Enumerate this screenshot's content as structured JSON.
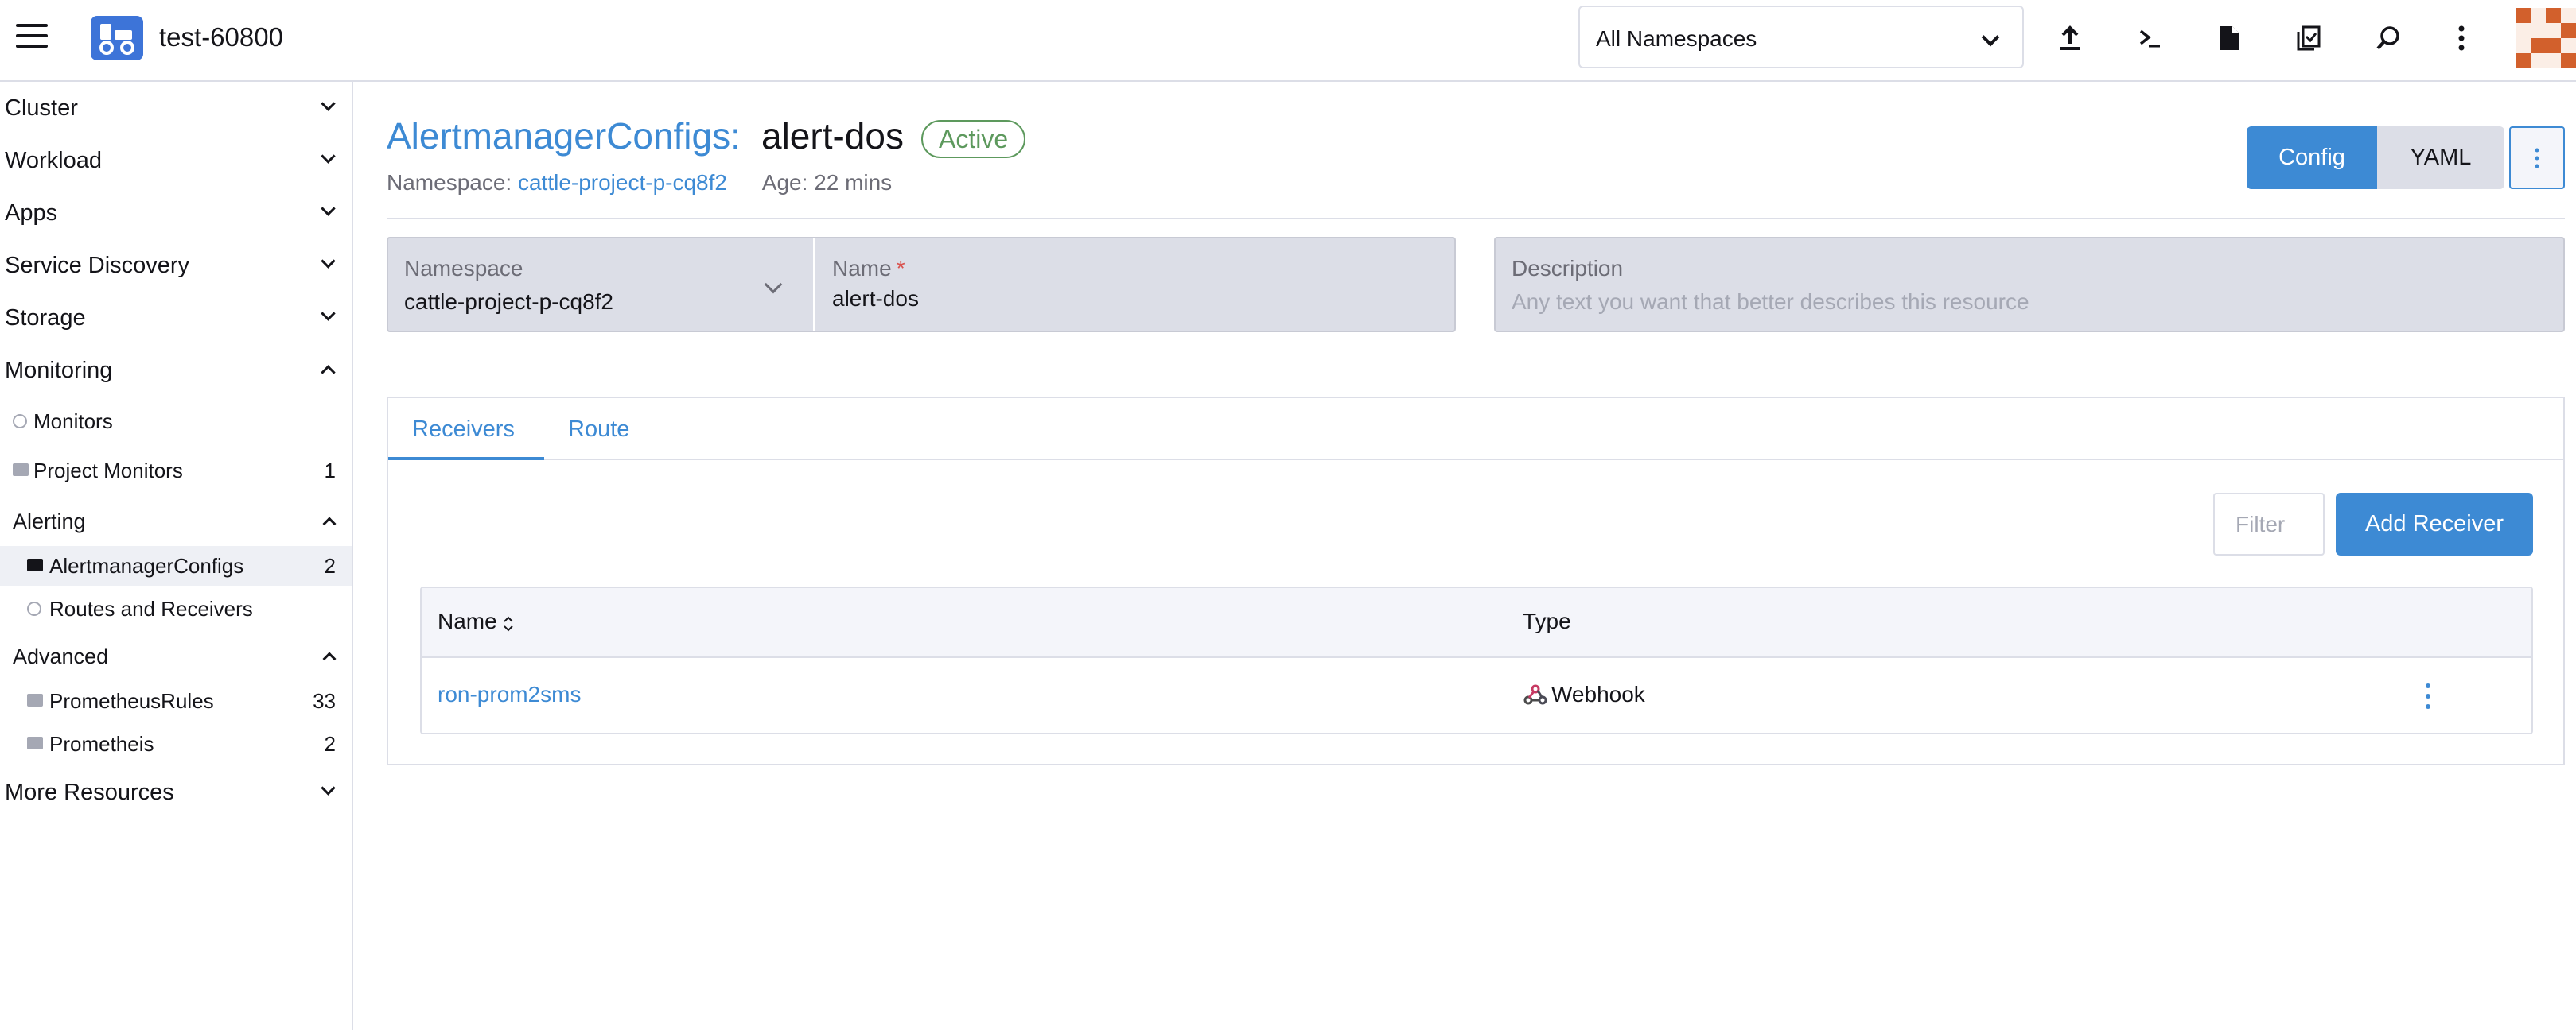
{
  "header": {
    "cluster_name": "test-60800",
    "namespace_filter": "All Namespaces",
    "icons": [
      "upload-icon",
      "shell-icon",
      "file-icon",
      "copy-check-icon",
      "search-icon",
      "more-vertical-icon"
    ]
  },
  "sidebar": {
    "groups": [
      {
        "label": "Cluster"
      },
      {
        "label": "Workload"
      },
      {
        "label": "Apps"
      },
      {
        "label": "Service Discovery"
      },
      {
        "label": "Storage"
      },
      {
        "label": "Monitoring"
      }
    ],
    "monitoring_items": [
      {
        "label": "Monitors",
        "count": ""
      },
      {
        "label": "Project Monitors",
        "count": "1"
      }
    ],
    "alerting": {
      "label": "Alerting"
    },
    "alerting_items": [
      {
        "label": "AlertmanagerConfigs",
        "count": "2"
      },
      {
        "label": "Routes and Receivers",
        "count": ""
      }
    ],
    "advanced": {
      "label": "Advanced"
    },
    "advanced_items": [
      {
        "label": "PrometheusRules",
        "count": "33"
      },
      {
        "label": "Prometheis",
        "count": "2"
      }
    ],
    "more_resources": "More Resources"
  },
  "page": {
    "resource_type": "AlertmanagerConfigs:",
    "resource_name": "alert-dos",
    "status": "Active",
    "namespace_label": "Namespace:",
    "namespace_value": "cattle-project-p-cq8f2",
    "age": "Age: 22 mins",
    "config_button": "Config",
    "yaml_button": "YAML"
  },
  "form": {
    "namespace_label": "Namespace",
    "namespace_value": "cattle-project-p-cq8f2",
    "name_label": "Name",
    "name_required": "*",
    "name_value": "alert-dos",
    "description_label": "Description",
    "description_placeholder": "Any text you want that better describes this resource"
  },
  "tabs": [
    {
      "label": "Receivers"
    },
    {
      "label": "Route"
    }
  ],
  "receivers": {
    "filter_placeholder": "Filter",
    "add_button": "Add Receiver",
    "columns": {
      "name": "Name",
      "type": "Type"
    },
    "rows": [
      {
        "name": "ron-prom2sms",
        "type": "Webhook"
      }
    ]
  },
  "colors": {
    "accent": "#3d8ad4",
    "active_badge": "#5d995d",
    "logo": "#3d74d8",
    "avatar": "#d2602c"
  }
}
